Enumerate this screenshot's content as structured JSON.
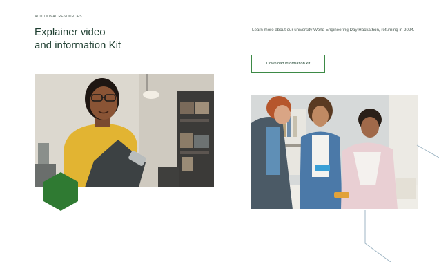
{
  "section": {
    "eyebrow": "ADDITIONAL RESOURCES",
    "title_line1": "Explainer video",
    "title_line2": "and information Kit"
  },
  "intro": {
    "text": "Learn more about our university World Engineering Day Hackathon, returning in 2024."
  },
  "download_button": {
    "label": "Download information kit"
  },
  "colors": {
    "brand_green": "#2f7a32",
    "button_border": "#3d8a46",
    "heading": "#1f3f31",
    "line_accent": "#9fb6c4"
  },
  "images": {
    "photo_1": "student-with-glasses-holding-clipboard",
    "photo_2": "group-of-students-working-at-table"
  }
}
